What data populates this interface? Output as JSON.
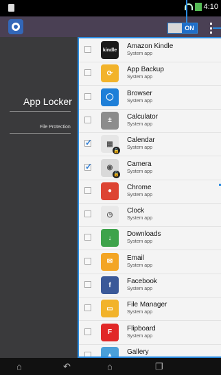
{
  "statusbar": {
    "time": "4:10"
  },
  "actionbar": {
    "toggle_label": "ON"
  },
  "panel": {
    "title": "App Locker",
    "subtitle": "File Protection"
  },
  "apps": [
    {
      "name": "Amazon Kindle",
      "sub": "System app",
      "checked": false,
      "icon": "kindle-icon",
      "color": "#1b1b1b",
      "glyph": "kindle",
      "locked": false
    },
    {
      "name": "App Backup",
      "sub": "System app",
      "checked": false,
      "icon": "app-backup-icon",
      "color": "#f2b32b",
      "glyph": "⟳",
      "locked": false
    },
    {
      "name": "Browser",
      "sub": "System app",
      "checked": false,
      "icon": "browser-icon",
      "color": "#1e7fd8",
      "glyph": "◯",
      "locked": false
    },
    {
      "name": "Calculator",
      "sub": "System app",
      "checked": false,
      "icon": "calculator-icon",
      "color": "#8c8c8c",
      "glyph": "±",
      "locked": false
    },
    {
      "name": "Calendar",
      "sub": "System app",
      "checked": true,
      "icon": "calendar-icon",
      "color": "#e6e6e6",
      "glyph": "▦",
      "locked": true
    },
    {
      "name": "Camera",
      "sub": "System app",
      "checked": true,
      "icon": "camera-icon",
      "color": "#d9d9d9",
      "glyph": "◉",
      "locked": true
    },
    {
      "name": "Chrome",
      "sub": "System app",
      "checked": false,
      "icon": "chrome-icon",
      "color": "#dd4433",
      "glyph": "●",
      "locked": false
    },
    {
      "name": "Clock",
      "sub": "System app",
      "checked": false,
      "icon": "clock-icon",
      "color": "#e9e9e9",
      "glyph": "◷",
      "locked": false
    },
    {
      "name": "Downloads",
      "sub": "System app",
      "checked": false,
      "icon": "downloads-icon",
      "color": "#3ea34b",
      "glyph": "↓",
      "locked": false
    },
    {
      "name": "Email",
      "sub": "System app",
      "checked": false,
      "icon": "email-icon",
      "color": "#f3a524",
      "glyph": "✉",
      "locked": false
    },
    {
      "name": "Facebook",
      "sub": "System app",
      "checked": false,
      "icon": "facebook-icon",
      "color": "#3b5998",
      "glyph": "f",
      "locked": false
    },
    {
      "name": "File Manager",
      "sub": "System app",
      "checked": false,
      "icon": "file-manager-icon",
      "color": "#f2b32b",
      "glyph": "▭",
      "locked": false
    },
    {
      "name": "Flipboard",
      "sub": "System app",
      "checked": false,
      "icon": "flipboard-icon",
      "color": "#e12828",
      "glyph": "F",
      "locked": false
    },
    {
      "name": "Gallery",
      "sub": "System app",
      "checked": false,
      "icon": "gallery-icon",
      "color": "#4a9fd8",
      "glyph": "▲",
      "locked": false
    }
  ]
}
